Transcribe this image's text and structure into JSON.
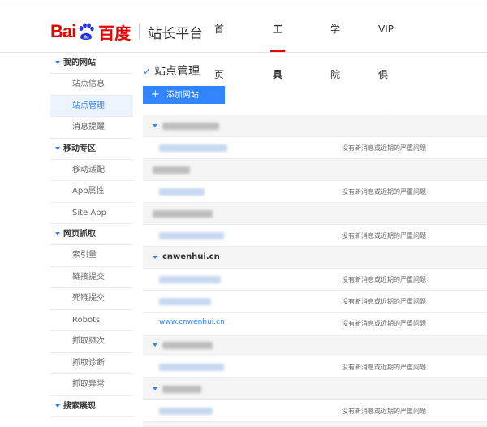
{
  "header": {
    "logo_text_bai": "Bai",
    "logo_text_du": "百度",
    "platform": "站长平台",
    "nav": [
      {
        "label": "首页",
        "active": false
      },
      {
        "label": "工具",
        "active": true
      },
      {
        "label": "学院",
        "active": false
      },
      {
        "label": "VIP俱乐部",
        "active": false
      }
    ]
  },
  "sidebar": {
    "groups": [
      {
        "label": "我的网站",
        "items": [
          "站点信息",
          "站点管理",
          "消息提醒"
        ]
      },
      {
        "label": "移动专区",
        "items": [
          "移动适配",
          "App属性",
          "Site App"
        ]
      },
      {
        "label": "网页抓取",
        "items": [
          "索引量",
          "链接提交",
          "死链提交",
          "Robots",
          "抓取频次",
          "抓取诊断",
          "抓取异常"
        ]
      },
      {
        "label": "搜索展现",
        "items": []
      }
    ],
    "active_item": "站点管理"
  },
  "main": {
    "title": "站点管理",
    "add_button": "添加网站",
    "status_text": "没有新消息或近期的严重问题",
    "rows": [
      {
        "type": "group",
        "label": ""
      },
      {
        "type": "site",
        "url": "",
        "status": "没有新消息或近期的严重问题"
      },
      {
        "type": "group",
        "label": ""
      },
      {
        "type": "site",
        "url": "",
        "status": "没有新消息或近期的严重问题"
      },
      {
        "type": "group",
        "label": ""
      },
      {
        "type": "site",
        "url": "",
        "status": "没有新消息或近期的严重问题"
      },
      {
        "type": "group",
        "label": "cnwenhui.cn"
      },
      {
        "type": "site",
        "url": "",
        "status": "没有新消息或近期的严重问题"
      },
      {
        "type": "site",
        "url": "",
        "status": "没有新消息或近期的严重问题"
      },
      {
        "type": "site",
        "url": "www.cnwenhui.cn",
        "status": "没有新消息或近期的严重问题"
      },
      {
        "type": "group",
        "label": ""
      },
      {
        "type": "site",
        "url": "",
        "status": "没有新消息或近期的严重问题"
      },
      {
        "type": "group",
        "label": ""
      },
      {
        "type": "site",
        "url": "",
        "status": "没有新消息或近期的严重问题"
      }
    ]
  },
  "colors": {
    "brand_red": "#e10601",
    "accent_blue": "#3385ff"
  }
}
